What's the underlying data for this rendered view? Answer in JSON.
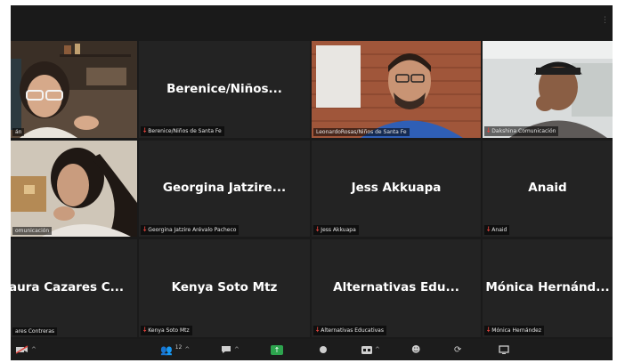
{
  "participant_count": "12",
  "tiles": [
    {
      "display": "",
      "label": "án",
      "muted": false
    },
    {
      "display": "Berenice/Niños...",
      "label": "Berenice/Niños de Santa Fe",
      "muted": true
    },
    {
      "display": "",
      "label": "LeonardoRosas/Niños de Santa Fe",
      "muted": false
    },
    {
      "display": "",
      "label": "Dakshina Comunicación",
      "muted": true
    },
    {
      "display": "",
      "label": "omunicación",
      "muted": false
    },
    {
      "display": "Georgina Jatzire...",
      "label": "Georgina Jatzire Arévalo Pacheco",
      "muted": true
    },
    {
      "display": "Jess Akkuapa",
      "label": "Jess Akkuapa",
      "muted": true
    },
    {
      "display": "Anaid",
      "label": "Anaid",
      "muted": true
    },
    {
      "display": "aura Cazares C...",
      "label": "ares Contreras",
      "muted": false
    },
    {
      "display": "Kenya Soto Mtz",
      "label": "Kenya Soto Mtz",
      "muted": true
    },
    {
      "display": "Alternativas Edu...",
      "label": "Alternativas Educativas",
      "muted": true
    },
    {
      "display": "Mónica Hernánd...",
      "label": "Mónica Hernández",
      "muted": true
    }
  ],
  "colors": {
    "active_speaker": "#c9e26a",
    "muted": "#e0433c",
    "share": "#2da44e"
  }
}
